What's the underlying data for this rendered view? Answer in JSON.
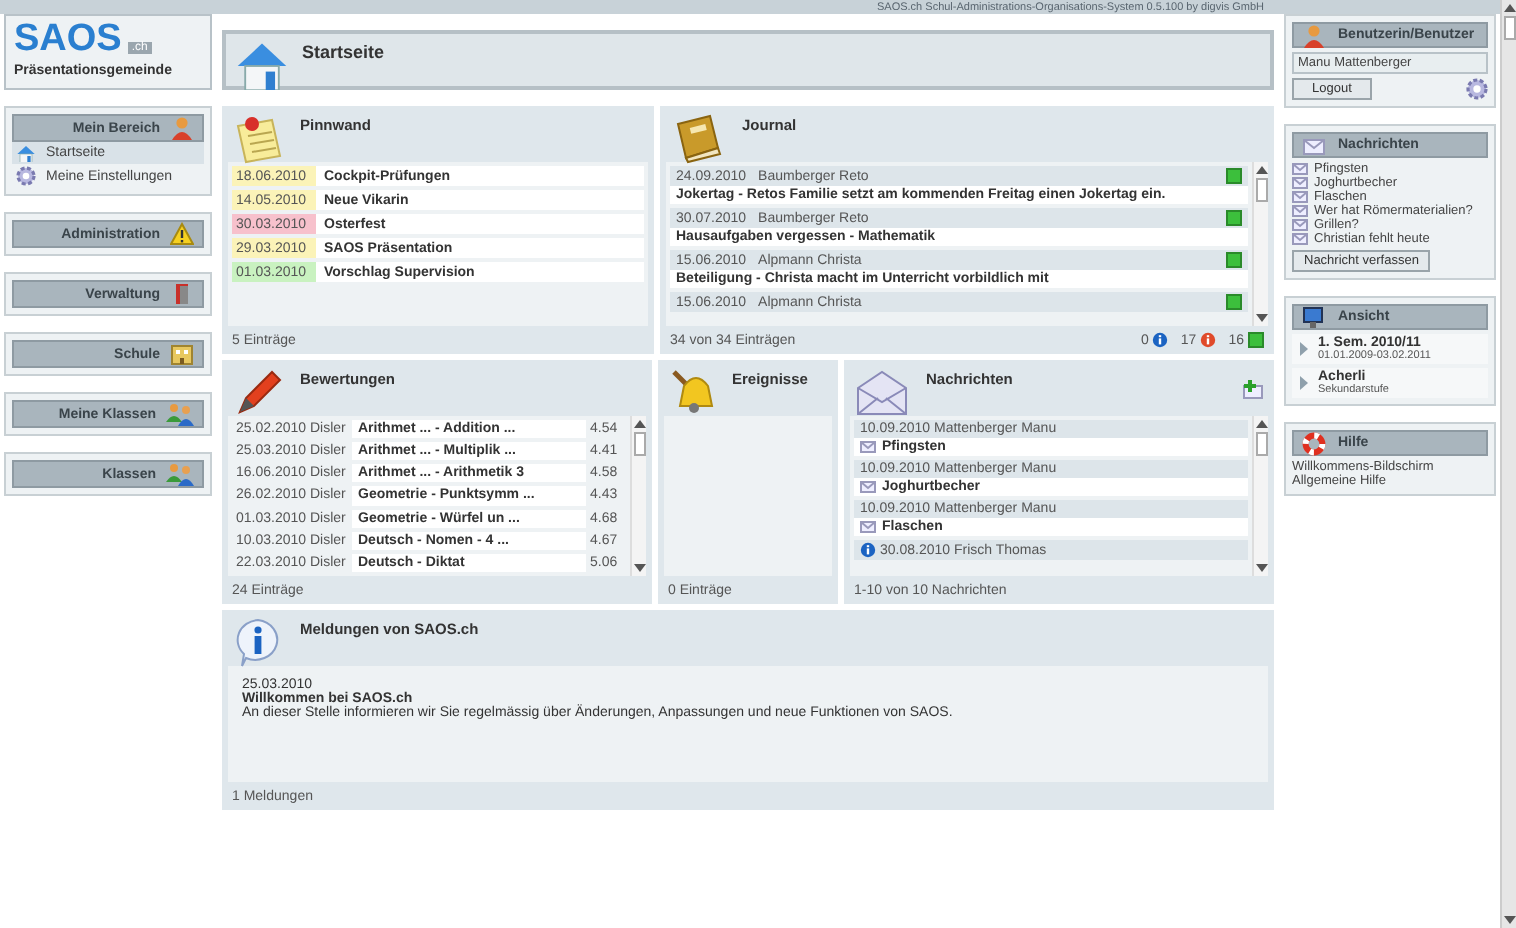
{
  "app": {
    "logo": "SAOS",
    "logo_suffix": ".ch",
    "community": "Präsentationsgemeinde",
    "credit": "SAOS.ch Schul-Administrations-Organisations-System 0.5.100 by digvis GmbH"
  },
  "sidebar": {
    "sections": [
      {
        "title": "Mein Bereich",
        "items": [
          {
            "label": "Startseite",
            "selected": true
          },
          {
            "label": "Meine Einstellungen",
            "selected": false
          }
        ]
      },
      {
        "title": "Administration"
      },
      {
        "title": "Verwaltung"
      },
      {
        "title": "Schule"
      },
      {
        "title": "Meine Klassen"
      },
      {
        "title": "Klassen"
      }
    ]
  },
  "page": {
    "title": "Startseite"
  },
  "pinnwand": {
    "title": "Pinnwand",
    "items": [
      {
        "date": "18.06.2010",
        "title": "Cockpit-Prüfungen",
        "color": "#fbf3b8"
      },
      {
        "date": "14.05.2010",
        "title": "Neue Vikarin",
        "color": "#fbf3b8"
      },
      {
        "date": "30.03.2010",
        "title": "Osterfest",
        "color": "#f7c1cc"
      },
      {
        "date": "29.03.2010",
        "title": "SAOS Präsentation",
        "color": "#fbf3b8"
      },
      {
        "date": "01.03.2010",
        "title": "Vorschlag Supervision",
        "color": "#c9f2c0"
      }
    ],
    "footer": "5 Einträge"
  },
  "journal": {
    "title": "Journal",
    "entries": [
      {
        "date": "24.09.2010",
        "author": "Baumberger Reto",
        "title": "Jokertag - Retos Familie setzt am kommenden Freitag einen Jokertag ein."
      },
      {
        "date": "30.07.2010",
        "author": "Baumberger Reto",
        "title": "Hausaufgaben vergessen - Mathematik"
      },
      {
        "date": "15.06.2010",
        "author": "Alpmann Christa",
        "title": "Beteiligung - Christa macht im Unterricht vorbildlich mit"
      },
      {
        "date": "15.06.2010",
        "author": "Alpmann Christa"
      }
    ],
    "footer": "34 von 34 Einträgen",
    "counts": [
      {
        "count": "0",
        "kind": "info"
      },
      {
        "count": "17",
        "kind": "error"
      },
      {
        "count": "16",
        "kind": "ok"
      }
    ]
  },
  "bewertungen": {
    "title": "Bewertungen",
    "rows": [
      {
        "date": "25.02.2010",
        "teacher": "Disler",
        "title": "Arithmet ... - Addition ...",
        "grade": "4.54"
      },
      {
        "date": "25.03.2010",
        "teacher": "Disler",
        "title": "Arithmet ... - Multiplik ...",
        "grade": "4.41"
      },
      {
        "date": "16.06.2010",
        "teacher": "Disler",
        "title": "Arithmet ... - Arithmetik 3",
        "grade": "4.58"
      },
      {
        "date": "26.02.2010",
        "teacher": "Disler",
        "title": "Geometrie - Punktsymm ...",
        "grade": "4.43"
      },
      {
        "date": "01.03.2010",
        "teacher": "Disler",
        "title": "Geometrie - Würfel un ...",
        "grade": "4.68"
      },
      {
        "date": "10.03.2010",
        "teacher": "Disler",
        "title": "Deutsch - Nomen - 4 ...",
        "grade": "4.67"
      },
      {
        "date": "22.03.2010",
        "teacher": "Disler",
        "title": "Deutsch - Diktat",
        "grade": "5.06"
      }
    ],
    "footer": "24 Einträge"
  },
  "ereignisse": {
    "title": "Ereignisse",
    "footer": "0 Einträge"
  },
  "nachrichten": {
    "title": "Nachrichten",
    "messages": [
      {
        "kind": "message",
        "date": "10.09.2010",
        "sender": "Mattenberger Manu",
        "title": "Pfingsten"
      },
      {
        "kind": "message",
        "date": "10.09.2010",
        "sender": "Mattenberger Manu",
        "title": "Joghurtbecher"
      },
      {
        "kind": "message",
        "date": "10.09.2010",
        "sender": "Mattenberger Manu",
        "title": "Flaschen"
      },
      {
        "kind": "info",
        "date": "30.08.2010",
        "sender": "Frisch Thomas"
      }
    ],
    "footer": "1-10 von 10 Nachrichten"
  },
  "meldungen": {
    "title": "Meldungen von SAOS.ch",
    "items": [
      {
        "date": "25.03.2010",
        "title": "Willkommen bei SAOS.ch",
        "text": "An dieser Stelle informieren wir Sie regelmässig über Änderungen, Anpassungen und neue Funktionen von SAOS."
      }
    ],
    "footer": "1 Meldungen"
  },
  "user_panel": {
    "title": "Benutzerin/Benutzer",
    "name": "Manu Mattenberger",
    "logout": "Logout"
  },
  "messages_panel": {
    "title": "Nachrichten",
    "items": [
      "Pfingsten",
      "Joghurtbecher",
      "Flaschen",
      "Wer hat Römermaterialien?",
      "Grillen?",
      "Christian fehlt heute"
    ],
    "button": "Nachricht verfassen"
  },
  "view_panel": {
    "title": "Ansicht",
    "items": [
      {
        "title": "1. Sem. 2010/11",
        "subtitle": "01.01.2009-03.02.2011"
      },
      {
        "title": "Acherli",
        "subtitle": "Sekundarstufe"
      }
    ]
  },
  "help_panel": {
    "title": "Hilfe",
    "links": [
      "Willkommens-Bildschirm",
      "Allgemeine Hilfe"
    ]
  }
}
